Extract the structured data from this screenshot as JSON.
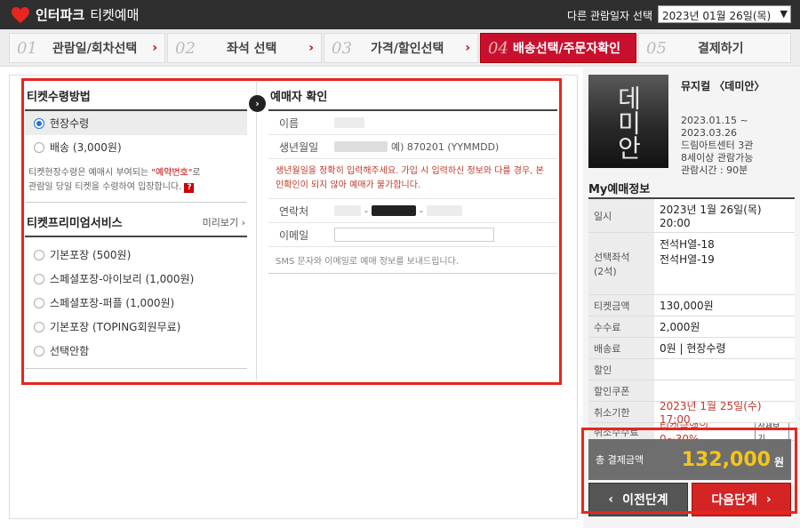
{
  "header": {
    "brand": "인터파크",
    "sub": "티켓예매",
    "date_label": "다른 관람일자 선택",
    "date_value": "2023년 01월 26일(목)"
  },
  "steps": [
    {
      "num": "01",
      "label": "관람일/회차선택"
    },
    {
      "num": "02",
      "label": "좌석 선택"
    },
    {
      "num": "03",
      "label": "가격/할인선택"
    },
    {
      "num": "04",
      "label": "배송선택/주문자확인"
    },
    {
      "num": "05",
      "label": "결제하기"
    }
  ],
  "receive": {
    "title": "티켓수령방법",
    "options": [
      "현장수령",
      "배송 (3,000원)"
    ],
    "note_pre": "티켓현장수령은 예매시 부여되는 ",
    "note_hl": "\"예약번호\"",
    "note_mid": "로",
    "note_post": "관람일 당일 티켓을 수령하여 입장합니다.",
    "help": "?"
  },
  "premium": {
    "title": "티켓프리미엄서비스",
    "preview": "미리보기 ›",
    "options": [
      "기본포장 (500원)",
      "스페셜포장-아이보리 (1,000원)",
      "스페셜포장-퍼플 (1,000원)",
      "기본포장 (TOPING회원무료)",
      "선택안함"
    ]
  },
  "buyer": {
    "title": "예매자 확인",
    "name_label": "이름",
    "birth_label": "생년월일",
    "birth_suffix": "예) 870201 (YYMMDD)",
    "warn": "생년월일을 정확히 입력해주세요. 가입 시 입력하신 정보와 다를 경우, 본인확인이 되지 않아 예매가 불가합니다.",
    "phone_label": "연락처",
    "email_label": "이메일",
    "sms_note": "SMS 문자와 이메일로 예매 정보를 보내드립니다."
  },
  "show": {
    "title": "뮤지컬 〈데미안〉",
    "period_start": "2023.01.15 ~",
    "period_end": "2023.03.26",
    "venue": "드림아트센터 3관",
    "age": "8세이상 관람가능",
    "runtime": "관람시간 : 90분",
    "poster_text": "데미안"
  },
  "my_info": {
    "title": "My예매정보",
    "rows": [
      {
        "k": "일시",
        "v": "2023년 1월 26일(목) 20:00"
      },
      {
        "k": "선택좌석\n(2석)",
        "v": "전석H열-18\n전석H열-19"
      },
      {
        "k": "티켓금액",
        "v": "130,000원"
      },
      {
        "k": "수수료",
        "v": "2,000원"
      },
      {
        "k": "배송료",
        "v": "0원 | 현장수령"
      },
      {
        "k": "할인",
        "v": ""
      },
      {
        "k": "할인쿠폰",
        "v": ""
      },
      {
        "k": "취소기한",
        "v": "2023년 1월 25일(수) 17:00"
      },
      {
        "k": "취소수수료",
        "v": "티켓금액의 0~30%",
        "btn": "상세보기"
      }
    ]
  },
  "total": {
    "label": "총 결제금액",
    "value": "132,000",
    "unit": "원"
  },
  "buttons": {
    "prev": "이전단계",
    "next": "다음단계"
  },
  "colors": {
    "accent": "#c8102e",
    "highlight_box": "#e8251e",
    "total_value": "#f5c518"
  }
}
